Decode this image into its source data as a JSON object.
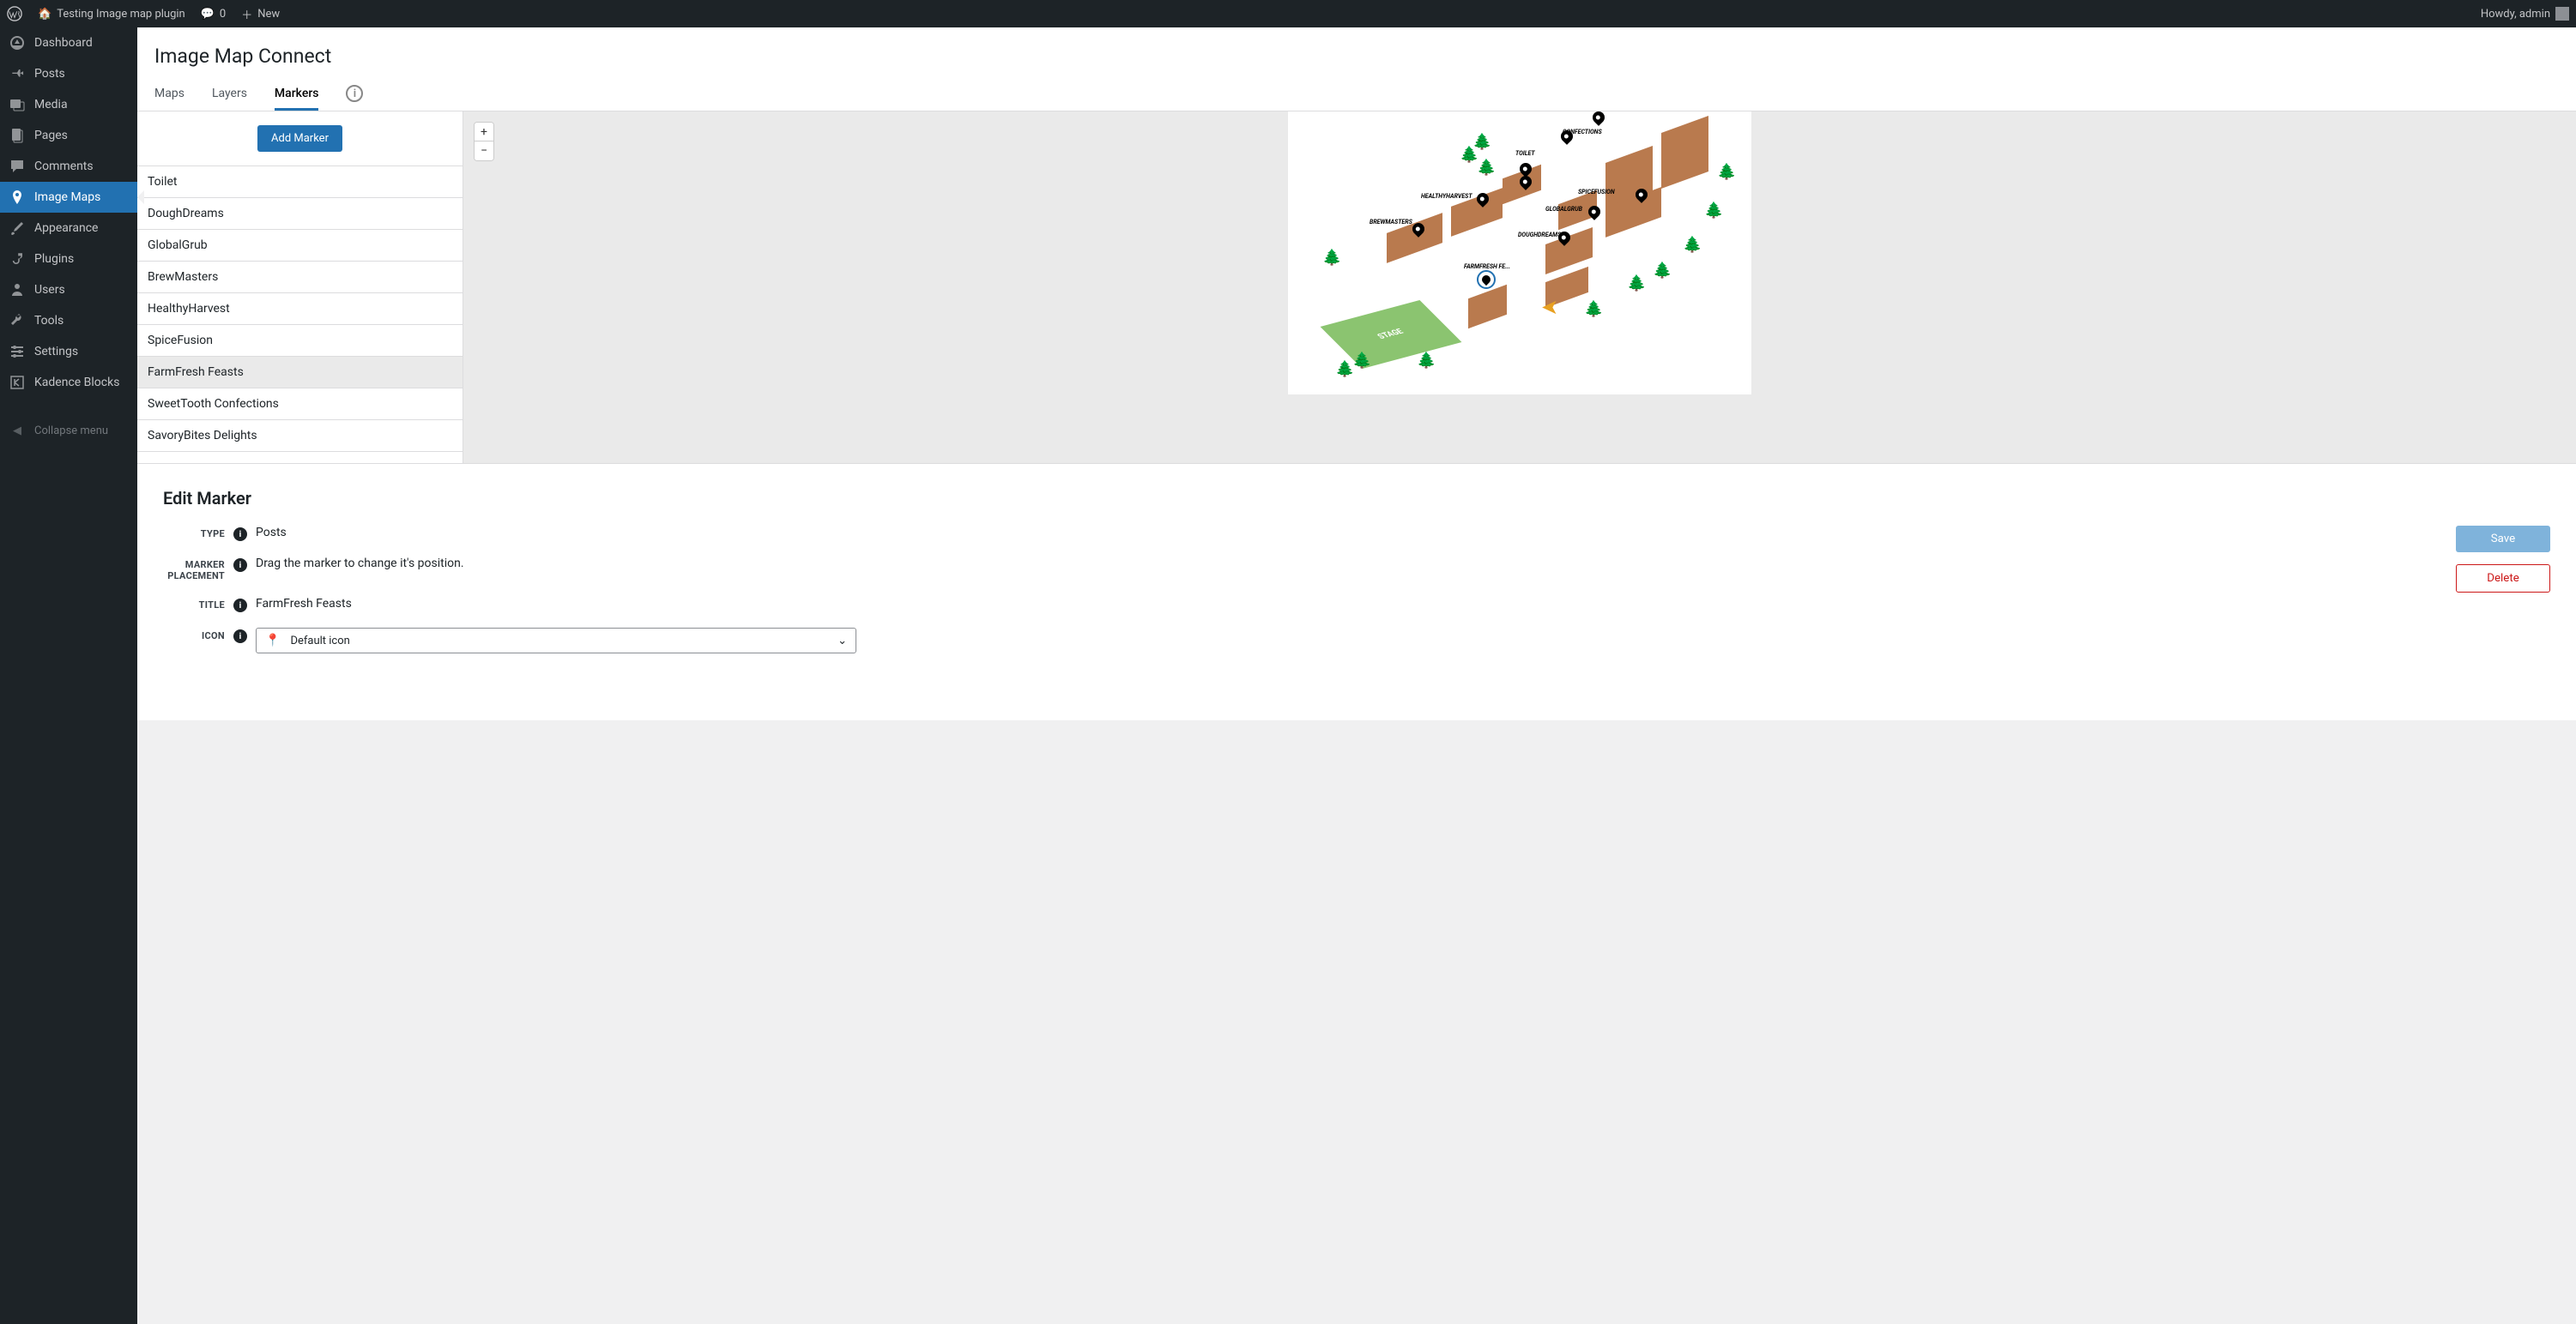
{
  "adminbar": {
    "site_name": "Testing Image map plugin",
    "comments": "0",
    "new_label": "New",
    "howdy": "Howdy, admin"
  },
  "sidebar": {
    "items": [
      {
        "label": "Dashboard",
        "icon": "dashboard"
      },
      {
        "label": "Posts",
        "icon": "pin"
      },
      {
        "label": "Media",
        "icon": "media"
      },
      {
        "label": "Pages",
        "icon": "pages"
      },
      {
        "label": "Comments",
        "icon": "comments"
      },
      {
        "label": "Image Maps",
        "icon": "location",
        "active": true
      },
      {
        "label": "Appearance",
        "icon": "brush"
      },
      {
        "label": "Plugins",
        "icon": "plug"
      },
      {
        "label": "Users",
        "icon": "users"
      },
      {
        "label": "Tools",
        "icon": "tools"
      },
      {
        "label": "Settings",
        "icon": "settings"
      },
      {
        "label": "Kadence Blocks",
        "icon": "kadence"
      }
    ],
    "collapse": "Collapse menu"
  },
  "page": {
    "title": "Image Map Connect"
  },
  "tabs": {
    "maps": "Maps",
    "layers": "Layers",
    "markers": "Markers"
  },
  "markerPanel": {
    "add": "Add Marker",
    "items": [
      "Toilet",
      "DoughDreams",
      "GlobalGrub",
      "BrewMasters",
      "HealthyHarvest",
      "SpiceFusion",
      "FarmFresh Feasts",
      "SweetTooth Confections",
      "SavoryBites Delights"
    ],
    "selected": "FarmFresh Feasts"
  },
  "mapLabels": {
    "stage": "STAGE",
    "toilet": "TOILET",
    "confections": "CONFECTIONS",
    "spicefusion": "SPICEFUSION",
    "globalgrub": "GLOBALGRUB",
    "doughdreams": "DOUGHDREAMS",
    "healthyharvest": "HEALTHYHARVEST",
    "brewmasters": "BREWMASTERS",
    "farmfresh": "FARMFRESH FE..."
  },
  "edit": {
    "title": "Edit Marker",
    "labels": {
      "type": "TYPE",
      "placement": "MARKER PLACEMENT",
      "titleLabel": "TITLE",
      "icon": "ICON"
    },
    "values": {
      "type": "Posts",
      "placement": "Drag the marker to change it's position.",
      "title": "FarmFresh Feasts",
      "icon": "Default icon"
    },
    "buttons": {
      "save": "Save",
      "delete": "Delete"
    }
  }
}
